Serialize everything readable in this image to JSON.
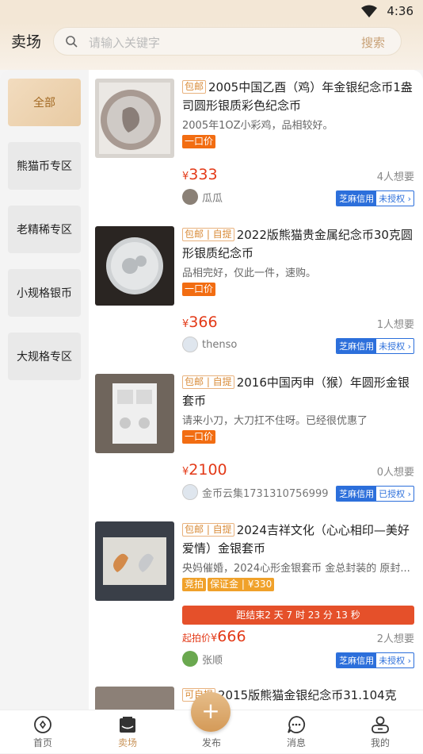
{
  "status": {
    "time": "4:36"
  },
  "header": {
    "title": "卖场",
    "search_placeholder": "请输入关键字",
    "search_button": "搜索"
  },
  "categories": [
    "全部",
    "熊猫币专区",
    "老精稀专区",
    "小规格银币",
    "大规格专区"
  ],
  "listings": [
    {
      "tags": [
        "包邮"
      ],
      "title": "2005中国乙酉（鸡）年金银纪念币1盎司圆形银质彩色纪念币",
      "desc": "2005年1OZ小彩鸡，品相较好。",
      "badges": [
        "一口价"
      ],
      "price_prefix": "",
      "currency": "¥",
      "price": "333",
      "want": "4人想要",
      "seller": "瓜瓜",
      "credit": "芝麻信用",
      "auth": "未授权 ›"
    },
    {
      "tags": [
        "包邮 | 自提"
      ],
      "title": "2022版熊猫贵金属纪念币30克圆形银质纪念币",
      "desc": "品相完好，仅此一件，速购。",
      "badges": [
        "一口价"
      ],
      "price_prefix": "",
      "currency": "¥",
      "price": "366",
      "want": "1人想要",
      "seller": "thenso",
      "credit": "芝麻信用",
      "auth": "未授权 ›"
    },
    {
      "tags": [
        "包邮 | 自提"
      ],
      "title": "2016中国丙申（猴）年圆形金银套币",
      "desc": "请来小刀，大刀扛不住呀。已经很优惠了",
      "badges": [
        "一口价"
      ],
      "price_prefix": "",
      "currency": "¥",
      "price": "2100",
      "want": "0人想要",
      "seller": "金币云集1731310756999",
      "credit": "芝麻信用",
      "auth": "已授权 ›"
    },
    {
      "tags": [
        "包邮 | 自提"
      ],
      "title": "2024吉祥文化（心心相印—美好爱情）金银套币",
      "desc": "央妈催婚，2024心形金银套币 金总封装的 原封...",
      "badges": [
        "竞拍",
        "保证金 | ¥330"
      ],
      "auction_text": "距结束2 天 7 时 23 分 13 秒",
      "price_prefix": "起拍价",
      "currency": "¥",
      "price": "666",
      "want": "2人想要",
      "seller": "张顺",
      "credit": "芝麻信用",
      "auth": "未授权 ›"
    },
    {
      "tags": [
        "可自提"
      ],
      "title": "2015版熊猫金银纪念币31.104克"
    }
  ],
  "tabbar": {
    "items": [
      "首页",
      "卖场",
      "发布",
      "消息",
      "我的"
    ],
    "publish_symbol": "+"
  },
  "colors": {
    "accent": "#c89256",
    "price": "#e33a18",
    "credit": "#2c6fdb"
  }
}
